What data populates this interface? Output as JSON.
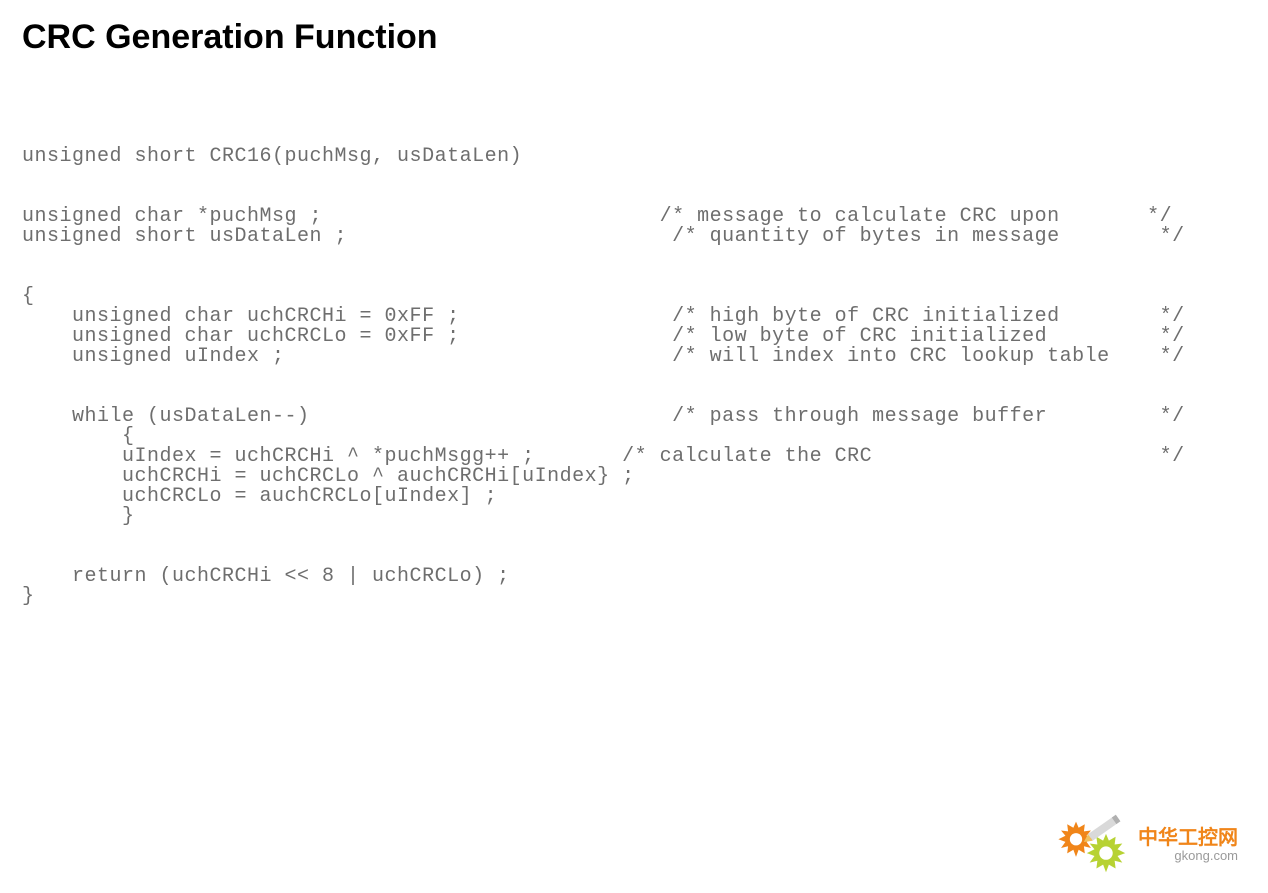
{
  "title": "CRC Generation Function",
  "code": {
    "l01": "unsigned short CRC16(puchMsg, usDataLen)",
    "l02": "",
    "l03": "",
    "l04": "unsigned char *puchMsg ;                           /* message to calculate CRC upon       */",
    "l05": "unsigned short usDataLen ;                          /* quantity of bytes in message        */",
    "l06": "",
    "l07": "",
    "l08": "{",
    "l09": "    unsigned char uchCRCHi = 0xFF ;                 /* high byte of CRC initialized        */",
    "l10": "    unsigned char uchCRCLo = 0xFF ;                 /* low byte of CRC initialized         */",
    "l11": "    unsigned uIndex ;                               /* will index into CRC lookup table    */",
    "l12": "",
    "l13": "",
    "l14": "    while (usDataLen--)                             /* pass through message buffer         */",
    "l15": "        {",
    "l16": "        uIndex = uchCRCHi ^ *puchMsgg++ ;       /* calculate the CRC                       */",
    "l17": "        uchCRCHi = uchCRCLo ^ auchCRCHi[uIndex} ;",
    "l18": "        uchCRCLo = auchCRCLo[uIndex] ;",
    "l19": "        }",
    "l20": "",
    "l21": "",
    "l22": "    return (uchCRCHi << 8 | uchCRCLo) ;",
    "l23": "}"
  },
  "logo": {
    "cn": "中华工控网",
    "url": "gkong.com",
    "color_orange": "#f08519",
    "color_green": "#b7d233"
  }
}
